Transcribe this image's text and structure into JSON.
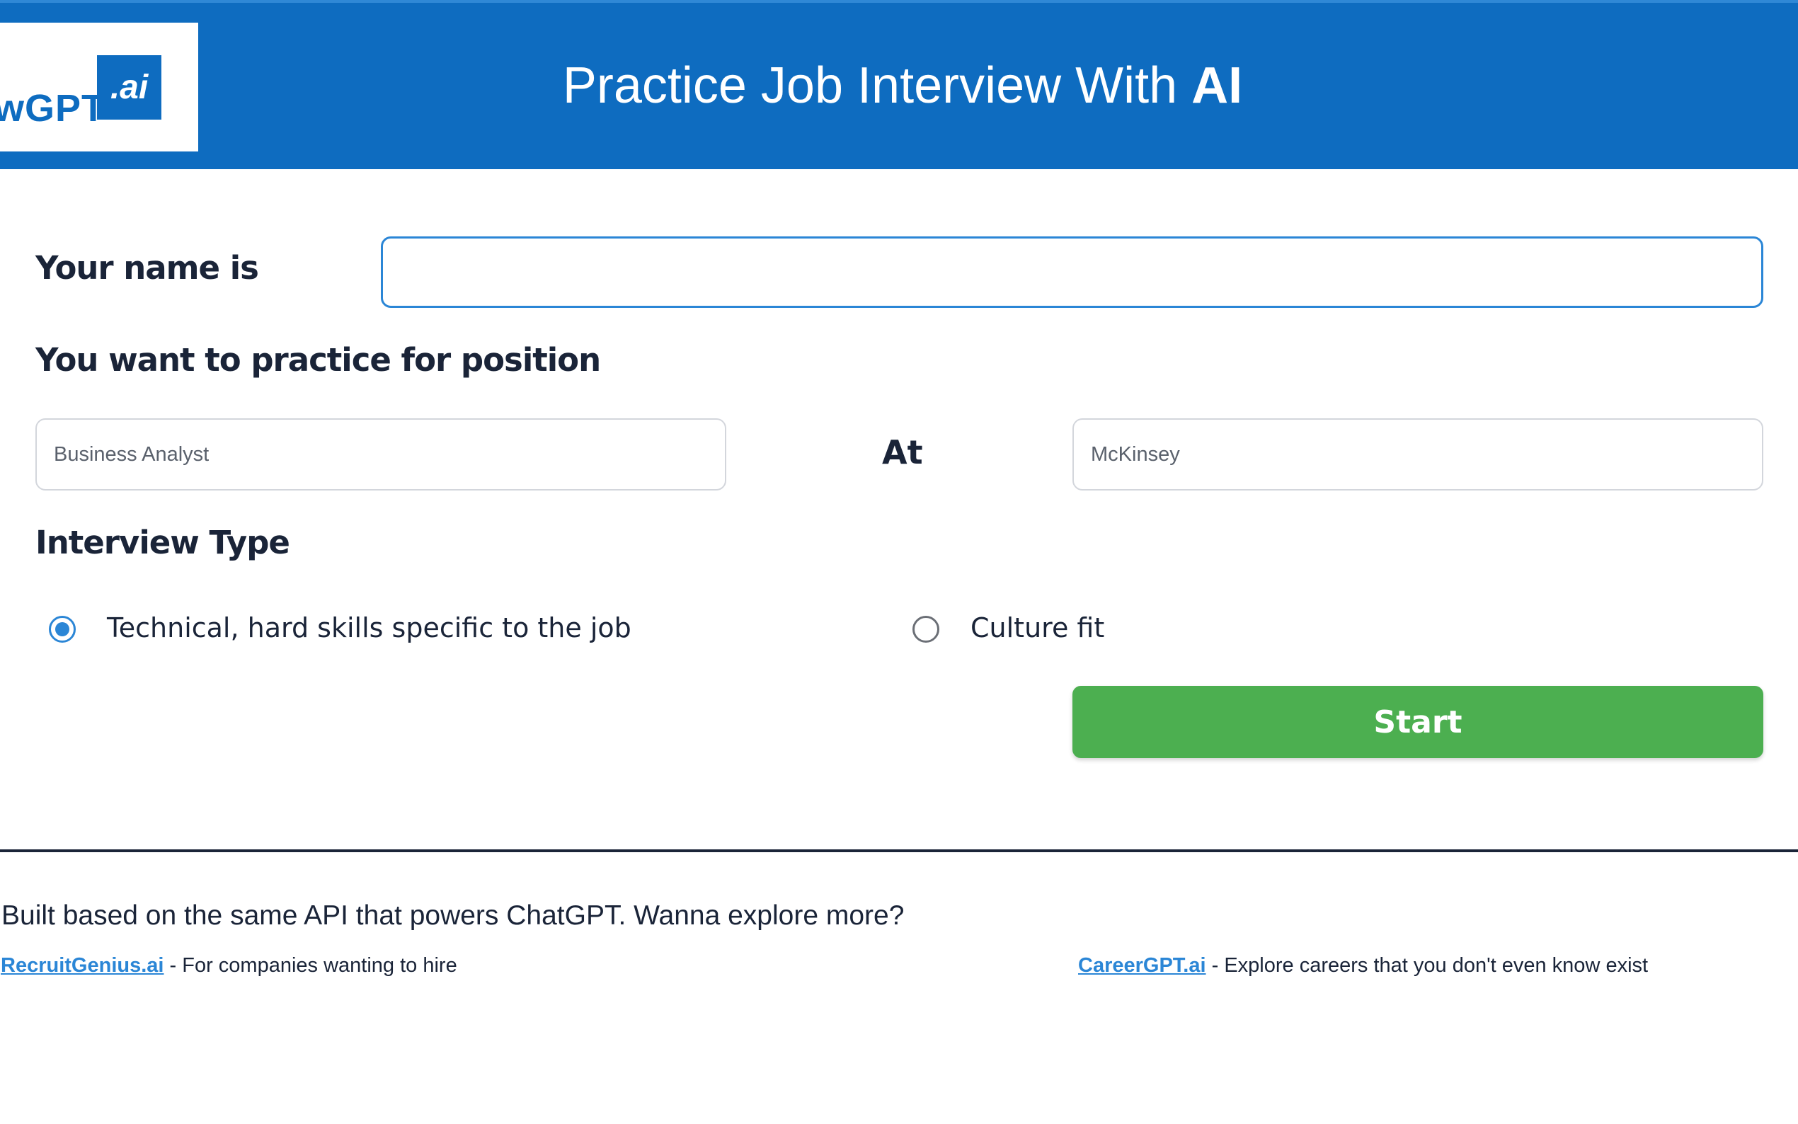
{
  "header": {
    "logo_text": "wGPT",
    "logo_badge": ".ai",
    "title_prefix": "Practice Job Interview With ",
    "title_emphasis": "AI"
  },
  "form": {
    "name_label": "Your name is",
    "name_value": "",
    "position_label": "You want to practice for position",
    "position_placeholder": "Business Analyst",
    "at_label": "At",
    "company_placeholder": "McKinsey",
    "interview_type_label": "Interview Type",
    "interview_types": [
      {
        "label": "Technical, hard skills specific to the job",
        "selected": true
      },
      {
        "label": "Culture fit",
        "selected": false
      }
    ],
    "start_label": "Start"
  },
  "footer": {
    "intro": "Built based on the same API that powers ChatGPT. Wanna explore more?",
    "links": [
      {
        "name": "RecruitGenius.ai",
        "description": " - For companies wanting to hire"
      },
      {
        "name": "CareerGPT.ai",
        "description": " - Explore careers that you don't even know exist"
      }
    ]
  },
  "colors": {
    "header_bg": "#0e6cc0",
    "accent_blue": "#2b86d6",
    "start_green": "#4caf50",
    "text_dark": "#1a2438"
  }
}
